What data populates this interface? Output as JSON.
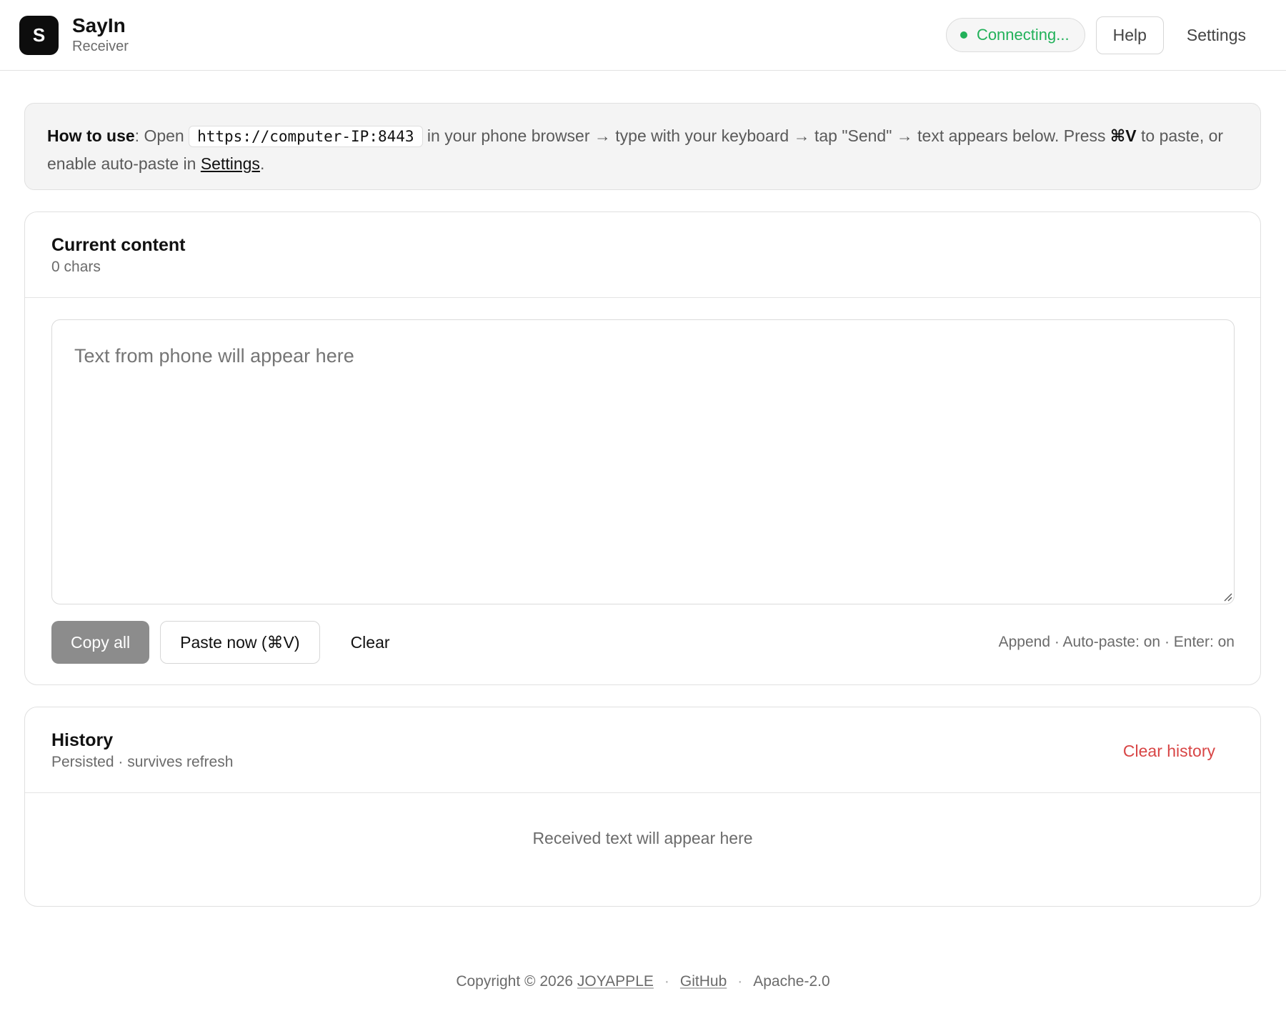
{
  "header": {
    "logo_letter": "S",
    "app_name": "SayIn",
    "app_subtitle": "Receiver",
    "status": "Connecting...",
    "help_label": "Help",
    "settings_label": "Settings"
  },
  "colors": {
    "status_green": "#22b15a",
    "danger_red": "#d84545",
    "primary_disabled_gray": "#8c8c8c"
  },
  "howto": {
    "label": "How to use",
    "open_prefix": ": Open ",
    "url": "https://computer-IP:8443",
    "steps_text": " in your phone browser → type with your keyboard → tap \"Send\" → text appears below. Press ",
    "shortcut": "⌘V",
    "suffix": " to paste, or enable auto-paste in ",
    "settings_link": "Settings",
    "period": "."
  },
  "current": {
    "title": "Current content",
    "char_count": "0 chars",
    "placeholder": "Text from phone will appear here",
    "copy_all_label": "Copy all",
    "paste_now_label": "Paste now (⌘V)",
    "clear_label": "Clear",
    "mode_info": "Append · Auto-paste: on · Enter: on"
  },
  "history": {
    "title": "History",
    "subtitle": "Persisted · survives refresh",
    "clear_label": "Clear history",
    "empty_text": "Received text will appear here"
  },
  "footer": {
    "copyright_prefix": "Copyright © 2026 ",
    "owner_link": "JOYAPPLE",
    "separator": "·",
    "github_link": "GitHub",
    "license": "Apache-2.0"
  }
}
